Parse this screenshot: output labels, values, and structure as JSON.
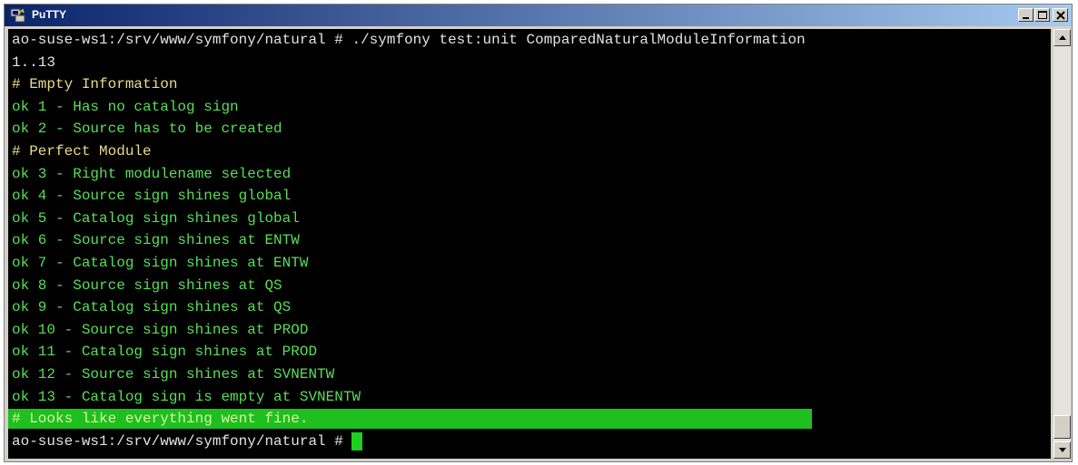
{
  "window": {
    "title": "PuTTY",
    "icon": "putty-icon",
    "controls": [
      "minimize-icon",
      "maximize-icon",
      "close-icon"
    ]
  },
  "colors": {
    "terminal_bg": "#000000",
    "prompt_text": "#e2e2e2",
    "comment_text": "#eadb8a",
    "ok_text": "#57df57",
    "highlight_bg": "#1fbf1f",
    "cursor": "#1fcf1f"
  },
  "terminal": {
    "lines": [
      {
        "text": "ao-suse-ws1:/srv/www/symfony/natural # ./symfony test:unit ComparedNaturalModuleInformation",
        "style": "prompt"
      },
      {
        "text": "1..13",
        "style": "prompt"
      },
      {
        "text": "# Empty Information",
        "style": "comment"
      },
      {
        "text": "ok 1 - Has no catalog sign",
        "style": "ok"
      },
      {
        "text": "ok 2 - Source has to be created",
        "style": "ok"
      },
      {
        "text": "# Perfect Module",
        "style": "comment"
      },
      {
        "text": "ok 3 - Right modulename selected",
        "style": "ok"
      },
      {
        "text": "ok 4 - Source sign shines global",
        "style": "ok"
      },
      {
        "text": "ok 5 - Catalog sign shines global",
        "style": "ok"
      },
      {
        "text": "ok 6 - Source sign shines at ENTW",
        "style": "ok"
      },
      {
        "text": "ok 7 - Catalog sign shines at ENTW",
        "style": "ok"
      },
      {
        "text": "ok 8 - Source sign shines at QS",
        "style": "ok"
      },
      {
        "text": "ok 9 - Catalog sign shines at QS",
        "style": "ok"
      },
      {
        "text": "ok 10 - Source sign shines at PROD",
        "style": "ok"
      },
      {
        "text": "ok 11 - Catalog sign shines at PROD",
        "style": "ok"
      },
      {
        "text": "ok 12 - Source sign shines at SVNENTW",
        "style": "ok"
      },
      {
        "text": "ok 13 - Catalog sign is empty at SVNENTW",
        "style": "ok"
      },
      {
        "text": "# Looks like everything went fine.",
        "style": "highlight"
      },
      {
        "text": "ao-suse-ws1:/srv/www/symfony/natural # ",
        "style": "prompt",
        "cursor": true
      }
    ]
  },
  "scrollbar": {
    "up_icon": "arrow-up-icon",
    "down_icon": "arrow-down-icon"
  }
}
